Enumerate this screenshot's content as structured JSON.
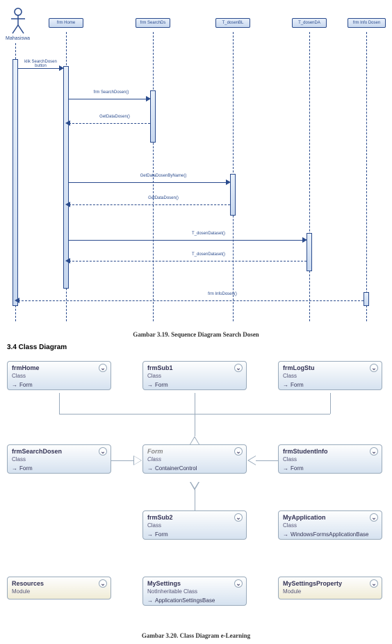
{
  "sequence": {
    "actor": "Mahasiswa",
    "lifelines": [
      "frm Home",
      "frm SearchDs",
      "T_dosenBL",
      "T_dosenDA",
      "frm Info Dosen"
    ],
    "messages": {
      "m1": "klik SearchDosen button",
      "m2": "frm SearchDosen()",
      "m3": "GetDataDosen()",
      "m4": "GetDataDosenByName()",
      "m5": "GetDataDosen()",
      "m6": "T_dosenDataset()",
      "m7": "T_dosenDataset()",
      "m8": "frm InfoDosen()"
    },
    "caption": "Gambar 3.19. Sequence Diagram Search Dosen"
  },
  "section_header": "3.4   Class Diagram",
  "classes": {
    "frmHome": {
      "name": "frmHome",
      "kind": "Class",
      "base": "Form"
    },
    "frmSub1": {
      "name": "frmSub1",
      "kind": "Class",
      "base": "Form"
    },
    "frmLogStu": {
      "name": "frmLogStu",
      "kind": "Class",
      "base": "Form"
    },
    "frmSearchDosen": {
      "name": "frmSearchDosen",
      "kind": "Class",
      "base": "Form"
    },
    "form": {
      "name": "Form",
      "kind": "Class",
      "base": "ContainerControl"
    },
    "frmStudentInfo": {
      "name": "frmStudentInfo",
      "kind": "Class",
      "base": "Form"
    },
    "frmSub2": {
      "name": "frmSub2",
      "kind": "Class",
      "base": "Form"
    },
    "myApplication": {
      "name": "MyApplication",
      "kind": "Class",
      "base": "WindowsFormsApplicationBase"
    },
    "resources": {
      "name": "Resources",
      "kind": "Module",
      "base": ""
    },
    "mySettings": {
      "name": "MySettings",
      "kind": "NotInheritable Class",
      "base": "ApplicationSettingsBase"
    },
    "mySettingsProperty": {
      "name": "MySettingsProperty",
      "kind": "Module",
      "base": ""
    }
  },
  "class_caption": "Gambar 3.20. Class Diagram e-Learning",
  "chart_data": [
    {
      "type": "sequence-diagram",
      "actor": "Mahasiswa",
      "participants": [
        "frm Home",
        "frm SearchDs",
        "T_dosenBL",
        "T_dosenDA",
        "frm Info Dosen"
      ],
      "messages": [
        {
          "from": "Mahasiswa",
          "to": "frm Home",
          "label": "klik SearchDosen button",
          "type": "sync"
        },
        {
          "from": "frm Home",
          "to": "frm SearchDs",
          "label": "frm SearchDosen()",
          "type": "sync"
        },
        {
          "from": "frm SearchDs",
          "to": "frm Home",
          "label": "GetDataDosen()",
          "type": "return"
        },
        {
          "from": "frm Home",
          "to": "T_dosenBL",
          "label": "GetDataDosenByName()",
          "type": "sync"
        },
        {
          "from": "T_dosenBL",
          "to": "frm Home",
          "label": "GetDataDosen()",
          "type": "return"
        },
        {
          "from": "frm Home",
          "to": "T_dosenDA",
          "label": "T_dosenDataset()",
          "type": "sync"
        },
        {
          "from": "T_dosenDA",
          "to": "frm Home",
          "label": "T_dosenDataset()",
          "type": "return"
        },
        {
          "from": "frm Info Dosen",
          "to": "Mahasiswa",
          "label": "frm InfoDosen()",
          "type": "return"
        }
      ]
    },
    {
      "type": "class-diagram",
      "classes": [
        "frmHome",
        "frmSub1",
        "frmLogStu",
        "frmSearchDosen",
        "Form",
        "frmStudentInfo",
        "frmSub2",
        "MyApplication",
        "Resources",
        "MySettings",
        "MySettingsProperty"
      ],
      "inheritance": [
        {
          "child": "frmHome",
          "parent": "Form"
        },
        {
          "child": "frmSub1",
          "parent": "Form"
        },
        {
          "child": "frmLogStu",
          "parent": "Form"
        },
        {
          "child": "frmSearchDosen",
          "parent": "Form"
        },
        {
          "child": "frmStudentInfo",
          "parent": "Form"
        },
        {
          "child": "frmSub2",
          "parent": "Form"
        }
      ]
    }
  ]
}
